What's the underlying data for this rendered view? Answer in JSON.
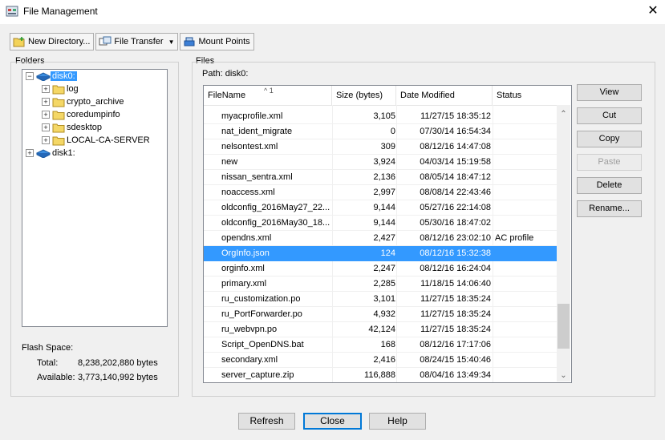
{
  "window": {
    "title": "File Management",
    "close_glyph": "✕"
  },
  "toolbar": {
    "new_directory": "New Directory...",
    "file_transfer": "File Transfer",
    "mount_points": "Mount Points"
  },
  "folders": {
    "label": "Folders",
    "tree": [
      {
        "label": "disk0:",
        "expander": "−"
      },
      {
        "label": "log",
        "expander": "+"
      },
      {
        "label": "crypto_archive",
        "expander": "+"
      },
      {
        "label": "coredumpinfo",
        "expander": "+"
      },
      {
        "label": "sdesktop",
        "expander": "+"
      },
      {
        "label": "LOCAL-CA-SERVER",
        "expander": "+"
      },
      {
        "label": "disk1:",
        "expander": "+"
      }
    ]
  },
  "flash": {
    "label": "Flash Space:",
    "total_label": "Total:",
    "total_value": "8,238,202,880 bytes",
    "available_label": "Available:",
    "available_value": "3,773,140,992 bytes"
  },
  "files": {
    "label": "Files",
    "path": "Path:  disk0:",
    "sort_indicator": "^ 1",
    "columns": [
      "FileName",
      "Size (bytes)",
      "Date Modified",
      "Status"
    ],
    "rows": [
      {
        "name": "myacprofile.xml",
        "size": "3,105",
        "date": "11/27/15 18:35:12",
        "status": ""
      },
      {
        "name": "nat_ident_migrate",
        "size": "0",
        "date": "07/30/14 16:54:34",
        "status": ""
      },
      {
        "name": "nelsontest.xml",
        "size": "309",
        "date": "08/12/16 14:47:08",
        "status": ""
      },
      {
        "name": "new",
        "size": "3,924",
        "date": "04/03/14 15:19:58",
        "status": ""
      },
      {
        "name": "nissan_sentra.xml",
        "size": "2,136",
        "date": "08/05/14 18:47:12",
        "status": ""
      },
      {
        "name": "noaccess.xml",
        "size": "2,997",
        "date": "08/08/14 22:43:46",
        "status": ""
      },
      {
        "name": "oldconfig_2016May27_22...",
        "size": "9,144",
        "date": "05/27/16 22:14:08",
        "status": ""
      },
      {
        "name": "oldconfig_2016May30_18...",
        "size": "9,144",
        "date": "05/30/16 18:47:02",
        "status": ""
      },
      {
        "name": "opendns.xml",
        "size": "2,427",
        "date": "08/12/16 23:02:10",
        "status": "AC profile"
      },
      {
        "name": "OrgInfo.json",
        "size": "124",
        "date": "08/12/16 15:32:38",
        "status": ""
      },
      {
        "name": "orginfo.xml",
        "size": "2,247",
        "date": "08/12/16 16:24:04",
        "status": ""
      },
      {
        "name": "primary.xml",
        "size": "2,285",
        "date": "11/18/15 14:06:40",
        "status": ""
      },
      {
        "name": "ru_customization.po",
        "size": "3,101",
        "date": "11/27/15 18:35:24",
        "status": ""
      },
      {
        "name": "ru_PortForwarder.po",
        "size": "4,932",
        "date": "11/27/15 18:35:24",
        "status": ""
      },
      {
        "name": "ru_webvpn.po",
        "size": "42,124",
        "date": "11/27/15 18:35:24",
        "status": ""
      },
      {
        "name": "Script_OpenDNS.bat",
        "size": "168",
        "date": "08/12/16 17:17:06",
        "status": ""
      },
      {
        "name": "secondary.xml",
        "size": "2,416",
        "date": "08/24/15 15:40:46",
        "status": ""
      },
      {
        "name": "server_capture.zip",
        "size": "116,888",
        "date": "08/04/16 13:49:34",
        "status": ""
      }
    ],
    "selected_index": 9
  },
  "actions": {
    "view": "View",
    "cut": "Cut",
    "copy": "Copy",
    "paste": "Paste",
    "delete": "Delete",
    "rename": "Rename..."
  },
  "bottom": {
    "refresh": "Refresh",
    "close": "Close",
    "help": "Help"
  },
  "colors": {
    "selection": "#3399ff",
    "default_button_border": "#0078d7"
  },
  "icons": [
    "app-icon",
    "folder-icon",
    "disk-icon",
    "new-folder-icon",
    "transfer-icon",
    "mount-icon"
  ]
}
